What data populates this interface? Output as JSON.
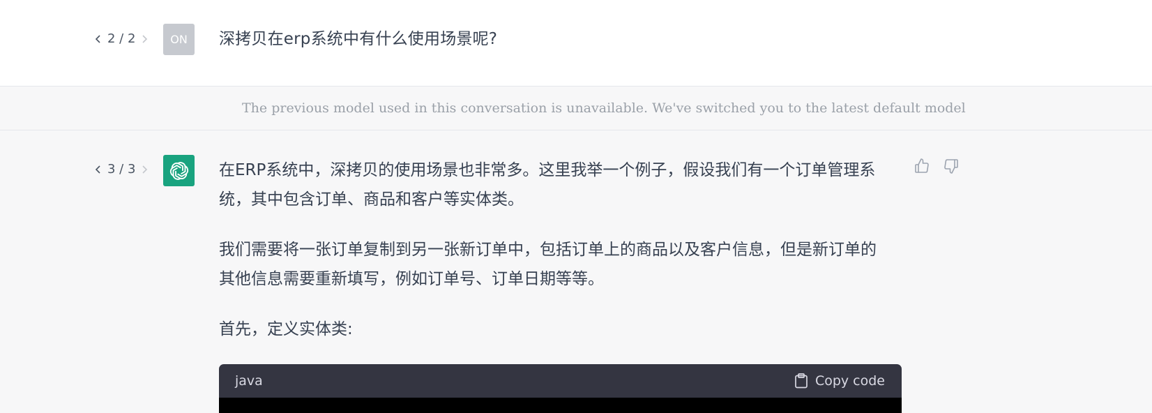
{
  "user_message": {
    "pager": {
      "current_total": "2 / 2"
    },
    "avatar_initials": "ON",
    "text": "深拷贝在erp系统中有什么使用场景呢?"
  },
  "notice": {
    "text": "The previous model used in this conversation is unavailable. We've switched you to the latest default model"
  },
  "assistant_message": {
    "pager": {
      "current_total": "3 / 3"
    },
    "avatar_icon": "openai-logo-icon",
    "paragraphs": [
      "在ERP系统中，深拷贝的使用场景也非常多。这里我举一个例子，假设我们有一个订单管理系统，其中包含订单、商品和客户等实体类。",
      "我们需要将一张订单复制到另一张新订单中，包括订单上的商品以及客户信息，但是新订单的其他信息需要重新填写，例如订单号、订单日期等等。",
      "首先，定义实体类:"
    ],
    "code_block": {
      "language": "java",
      "copy_label": "Copy code"
    },
    "feedback": {
      "up_icon": "thumbs-up-icon",
      "down_icon": "thumbs-down-icon"
    }
  },
  "colors": {
    "assistant_avatar": "#19a37f",
    "user_avatar": "#c6c9cf",
    "code_header": "#343541",
    "row_background": "#f7f7f8"
  }
}
